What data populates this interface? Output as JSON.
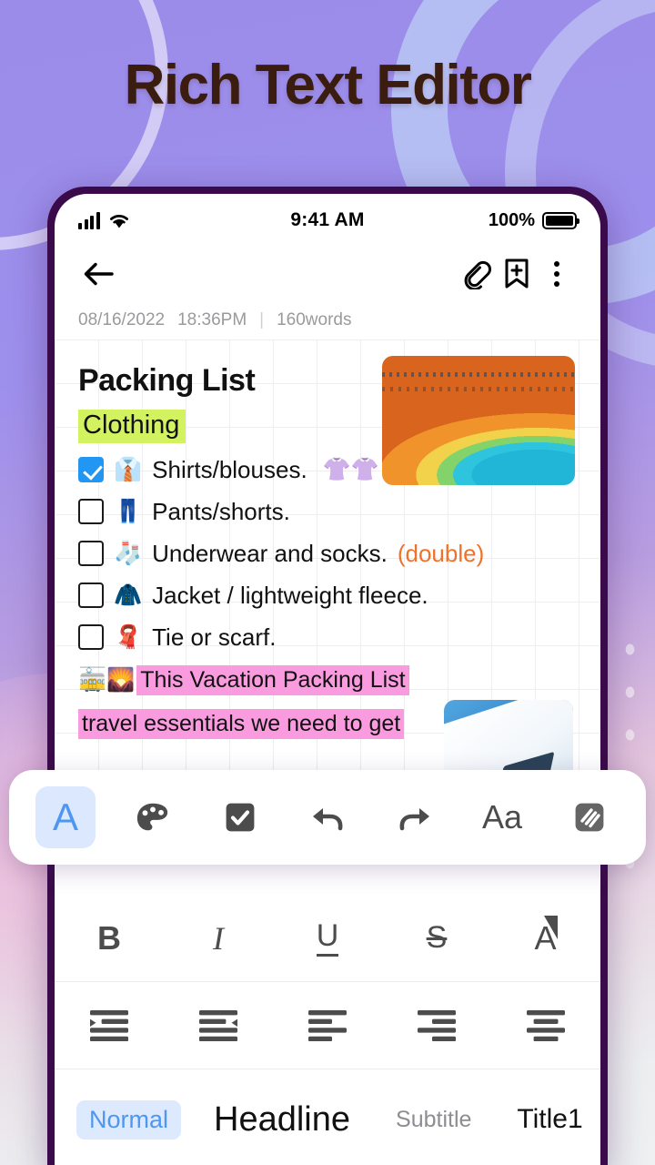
{
  "hero": {
    "title": "Rich Text Editor"
  },
  "status_bar": {
    "time": "9:41 AM",
    "battery_percent": "100%",
    "signal_icon": "cellular-signal-icon",
    "wifi_icon": "wifi-icon",
    "battery_icon": "battery-full-icon"
  },
  "app_bar": {
    "back_icon": "back-arrow-icon",
    "attach_icon": "link-attachment-icon",
    "bookmark_icon": "bookmark-add-icon",
    "more_icon": "more-vertical-icon"
  },
  "meta": {
    "date": "08/16/2022",
    "time": "18:36PM",
    "divider": "|",
    "word_count": "160words"
  },
  "note": {
    "title": "Packing List",
    "section_heading": "Clothing",
    "section_highlight_color": "#d3f25f",
    "items": [
      {
        "checked": true,
        "emoji": "👔",
        "text": "Shirts/blouses.",
        "suffix_emoji": "👚👚",
        "note": ""
      },
      {
        "checked": false,
        "emoji": "👖",
        "text": "Pants/shorts.",
        "suffix_emoji": "",
        "note": ""
      },
      {
        "checked": false,
        "emoji": "🧦",
        "text": "Underwear and socks.",
        "suffix_emoji": "",
        "note": "(double)"
      },
      {
        "checked": false,
        "emoji": "🧥",
        "text": "Jacket / lightweight fleece.",
        "suffix_emoji": "",
        "note": ""
      },
      {
        "checked": false,
        "emoji": "🧣",
        "text": "Tie or scarf.",
        "suffix_emoji": "",
        "note": ""
      }
    ],
    "note_color": "#f0722a",
    "paragraph": {
      "lead_emoji": "🚋🌄",
      "line1": "This Vacation Packing List",
      "line2": "travel  essentials  we need  to get",
      "highlight_color": "#fb9bdf"
    },
    "images": [
      {
        "name": "grand-prismatic-spring-photo"
      },
      {
        "name": "airplane-wing-photo"
      }
    ]
  },
  "float_toolbar": {
    "items": [
      {
        "name": "text-format-icon",
        "glyph": "A",
        "active": true
      },
      {
        "name": "color-palette-icon",
        "glyph": "",
        "active": false
      },
      {
        "name": "checklist-icon",
        "glyph": "",
        "active": false
      },
      {
        "name": "undo-icon",
        "glyph": "",
        "active": false
      },
      {
        "name": "redo-icon",
        "glyph": "",
        "active": false
      },
      {
        "name": "font-size-icon",
        "glyph": "Aa",
        "active": false
      },
      {
        "name": "highlighter-icon",
        "glyph": "",
        "active": false
      }
    ],
    "active_accent": "#4d97f2",
    "active_bg": "#dbe8fd"
  },
  "format_panel": {
    "row_text": [
      {
        "name": "bold-button",
        "label": "B"
      },
      {
        "name": "italic-button",
        "label": "I"
      },
      {
        "name": "underline-button",
        "label": "U"
      },
      {
        "name": "strikethrough-button",
        "label": "S"
      },
      {
        "name": "text-color-button",
        "label": "A"
      }
    ],
    "row_align": [
      {
        "name": "indent-increase-button"
      },
      {
        "name": "indent-decrease-button"
      },
      {
        "name": "align-left-button"
      },
      {
        "name": "align-right-button"
      },
      {
        "name": "align-center-button"
      }
    ],
    "styles": [
      {
        "name": "style-normal",
        "label": "Normal",
        "active": true
      },
      {
        "name": "style-headline",
        "label": "Headline",
        "active": false
      },
      {
        "name": "style-subtitle",
        "label": "Subtitle",
        "active": false
      },
      {
        "name": "style-title1",
        "label": "Title1",
        "active": false
      }
    ]
  }
}
